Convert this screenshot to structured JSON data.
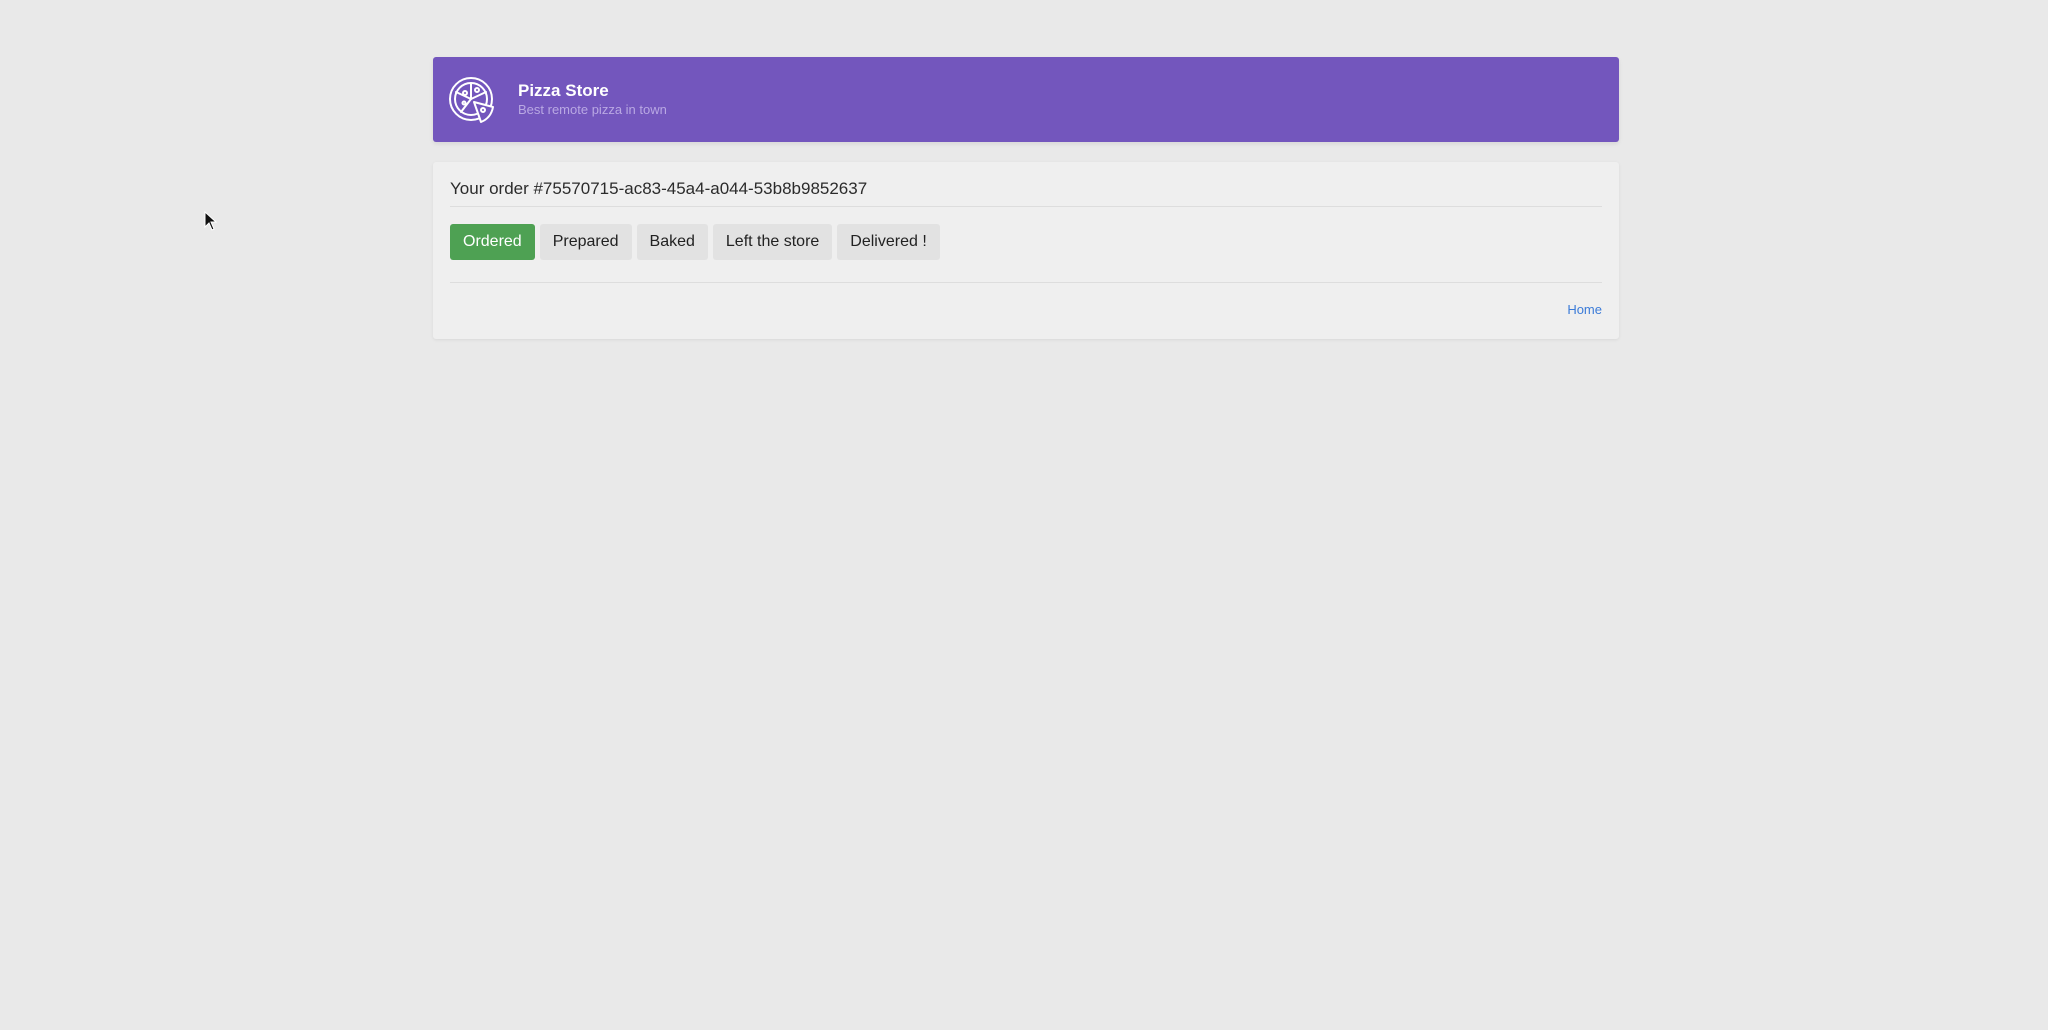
{
  "header": {
    "logo_icon": "pizza-icon",
    "title": "Pizza Store",
    "subtitle": "Best remote pizza in town",
    "background_color": "#7356bd"
  },
  "order": {
    "title": "Your order #75570715-ac83-45a4-a044-53b8b9852637",
    "statuses": [
      {
        "label": "Ordered",
        "active": true
      },
      {
        "label": "Prepared",
        "active": false
      },
      {
        "label": "Baked",
        "active": false
      },
      {
        "label": "Left the store",
        "active": false
      },
      {
        "label": "Delivered !",
        "active": false
      }
    ],
    "active_color": "#4ea153"
  },
  "footer": {
    "home_label": "Home"
  },
  "cursor_icon": "mouse-pointer-icon"
}
